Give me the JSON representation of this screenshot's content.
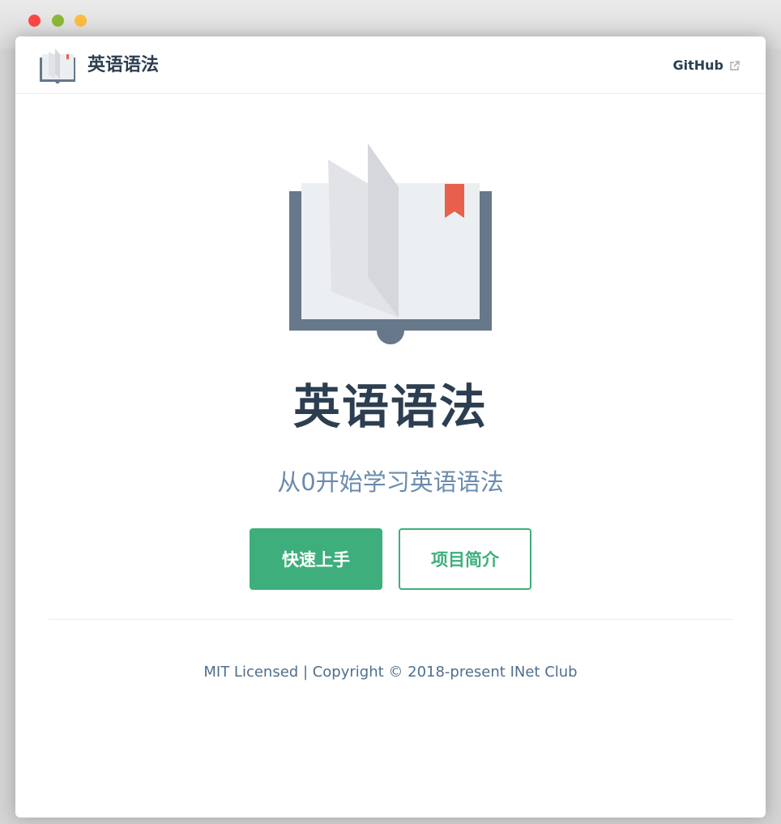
{
  "navbar": {
    "title": "英语语法",
    "github_label": "GitHub",
    "logo_icon": "open-book-icon",
    "external_icon": "external-link-icon"
  },
  "hero": {
    "image_icon": "open-book-icon",
    "title": "英语语法",
    "description": "从0开始学习英语语法",
    "primary_action": "快速上手",
    "secondary_action": "项目简介"
  },
  "footer": {
    "text": "MIT Licensed | Copyright © 2018-present INet Club"
  },
  "colors": {
    "accent": "#3eaf7c",
    "title": "#2c3e50",
    "description": "#6a8bad",
    "book_cover": "#66788a",
    "bookmark": "#e8604c"
  }
}
